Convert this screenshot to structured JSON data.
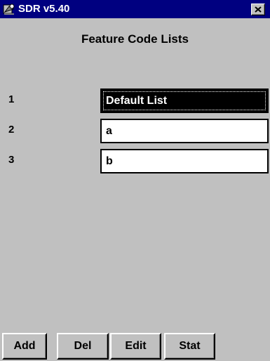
{
  "window": {
    "title": "SDR v5.40",
    "icons": {
      "app": "sdr-app-icon",
      "close": "close-icon"
    }
  },
  "page": {
    "heading": "Feature Code Lists"
  },
  "lists": [
    {
      "number": "1",
      "name": "Default List",
      "selected": true
    },
    {
      "number": "2",
      "name": "a",
      "selected": false
    },
    {
      "number": "3",
      "name": "b",
      "selected": false
    }
  ],
  "buttons": {
    "add": "Add",
    "del": "Del",
    "edit": "Edit",
    "stat": "Stat"
  },
  "colors": {
    "titlebar": "#000080",
    "window_face": "#c0c0c0",
    "selected_bg": "#000000",
    "field_bg": "#ffffff"
  }
}
